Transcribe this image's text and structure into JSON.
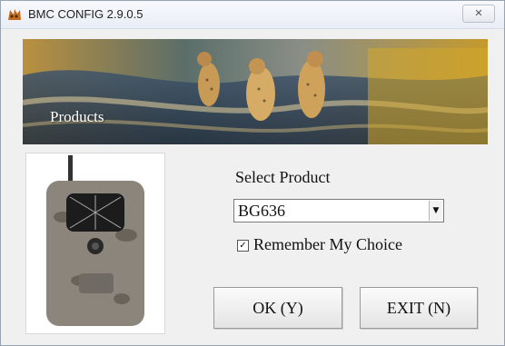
{
  "window": {
    "title": "BMC CONFIG 2.9.0.5",
    "close_symbol": "✕"
  },
  "banner": {
    "label": "Products"
  },
  "form": {
    "select_label": "Select Product",
    "selected_product": "BG636",
    "dropdown_arrow": "▼",
    "remember_checked": true,
    "checkbox_mark": "✓",
    "remember_label": "Remember My Choice"
  },
  "buttons": {
    "ok_label": "OK (Y)",
    "exit_label": "EXIT (N)"
  },
  "icons": {
    "app": "bmc-app-icon",
    "close": "close-icon",
    "banner": "cheetahs-banner-image",
    "product": "trail-camera-image",
    "dropdown": "dropdown-arrow-icon"
  }
}
